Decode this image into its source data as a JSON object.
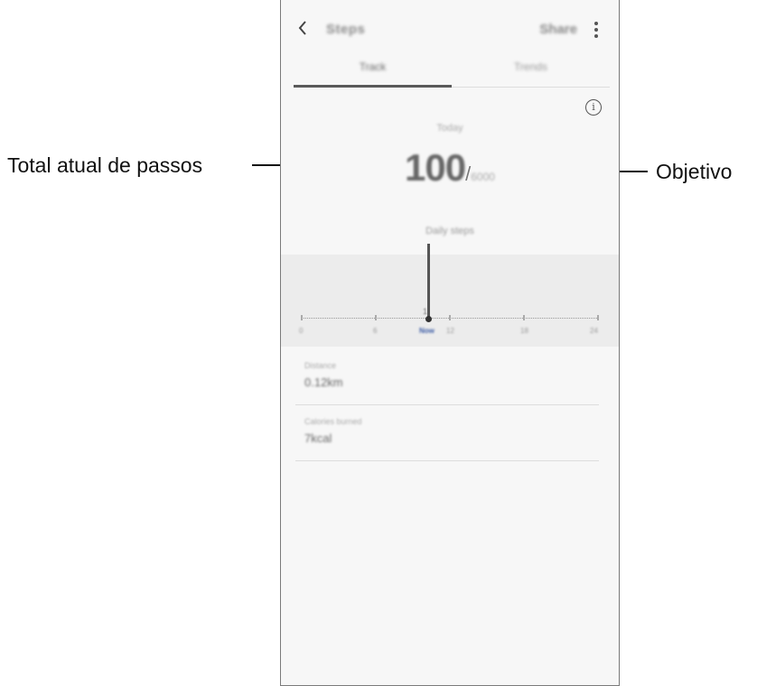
{
  "callouts": {
    "left_label": "Total atual de passos",
    "right_label": "Objetivo"
  },
  "screen": {
    "header": {
      "back_icon": "back-arrow-icon",
      "title": "Steps",
      "share_label": "Share",
      "more_icon": "more-vertical-icon"
    },
    "tabs": [
      {
        "label": "Track",
        "selected": true
      },
      {
        "label": "Trends",
        "selected": false
      }
    ],
    "info_icon": "info-icon",
    "summary": {
      "period_label": "Today",
      "steps_value": "100",
      "separator": "/",
      "steps_target": "6000",
      "daily_label": "Daily steps"
    },
    "graph": {
      "peak_label": "1",
      "tick_labels": [
        "0",
        "6",
        "Now",
        "12",
        "18",
        "24"
      ],
      "now_label": "Now"
    },
    "stats": {
      "distance_label": "Distance",
      "distance_value": "0.12km",
      "calories_label": "Calories burned",
      "calories_value": "7kcal"
    }
  },
  "colors": {
    "accent_now": "#3b5ba5",
    "graph_background": "#ececec"
  }
}
